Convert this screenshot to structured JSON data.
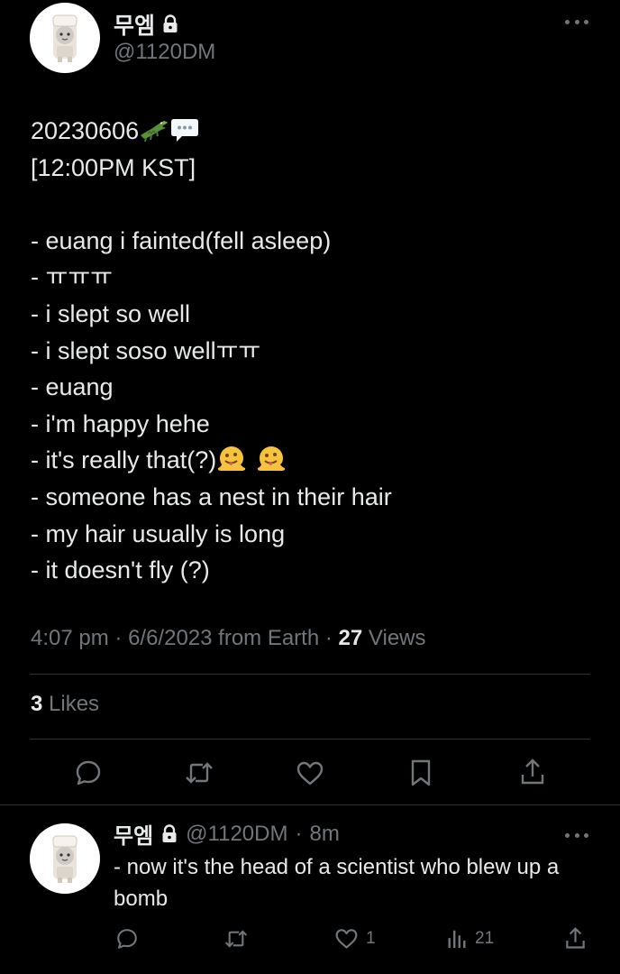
{
  "tweet": {
    "display_name": "무엠",
    "handle": "@1120DM",
    "lines": [
      "20230606",
      "[12:00PM KST]",
      "",
      "- euang i fainted(fell asleep)",
      "- ㅠㅠㅠ",
      "- i slept so well",
      "- i slept soso wellㅠㅠ",
      "- euang",
      "- i'm happy hehe",
      "- it's really that(?)",
      "- someone has a nest in their hair",
      "- my hair usually is long",
      "- it doesn't fly (?)"
    ],
    "time": "4:07 pm",
    "date": "6/6/2023",
    "source": "from Earth",
    "views_count": "27",
    "views_label": "Views",
    "likes_count": "3",
    "likes_label": "Likes",
    "separator": "·"
  },
  "reply": {
    "display_name": "무엠",
    "handle": "@1120DM",
    "time": "8m",
    "separator": "·",
    "text": "- now it's the head of a scientist who blew up a bomb",
    "likes": "1",
    "views": "21"
  },
  "icons": {
    "emoji_1": "crocodile-emoji",
    "emoji_2": "speech-bubble-emoji",
    "emoji_3": "melting-face-emoji",
    "lock": "lock-icon"
  },
  "colors": {
    "background": "#000000",
    "text": "#e7e9ea",
    "muted": "#71767b",
    "divider": "#2f3336"
  }
}
